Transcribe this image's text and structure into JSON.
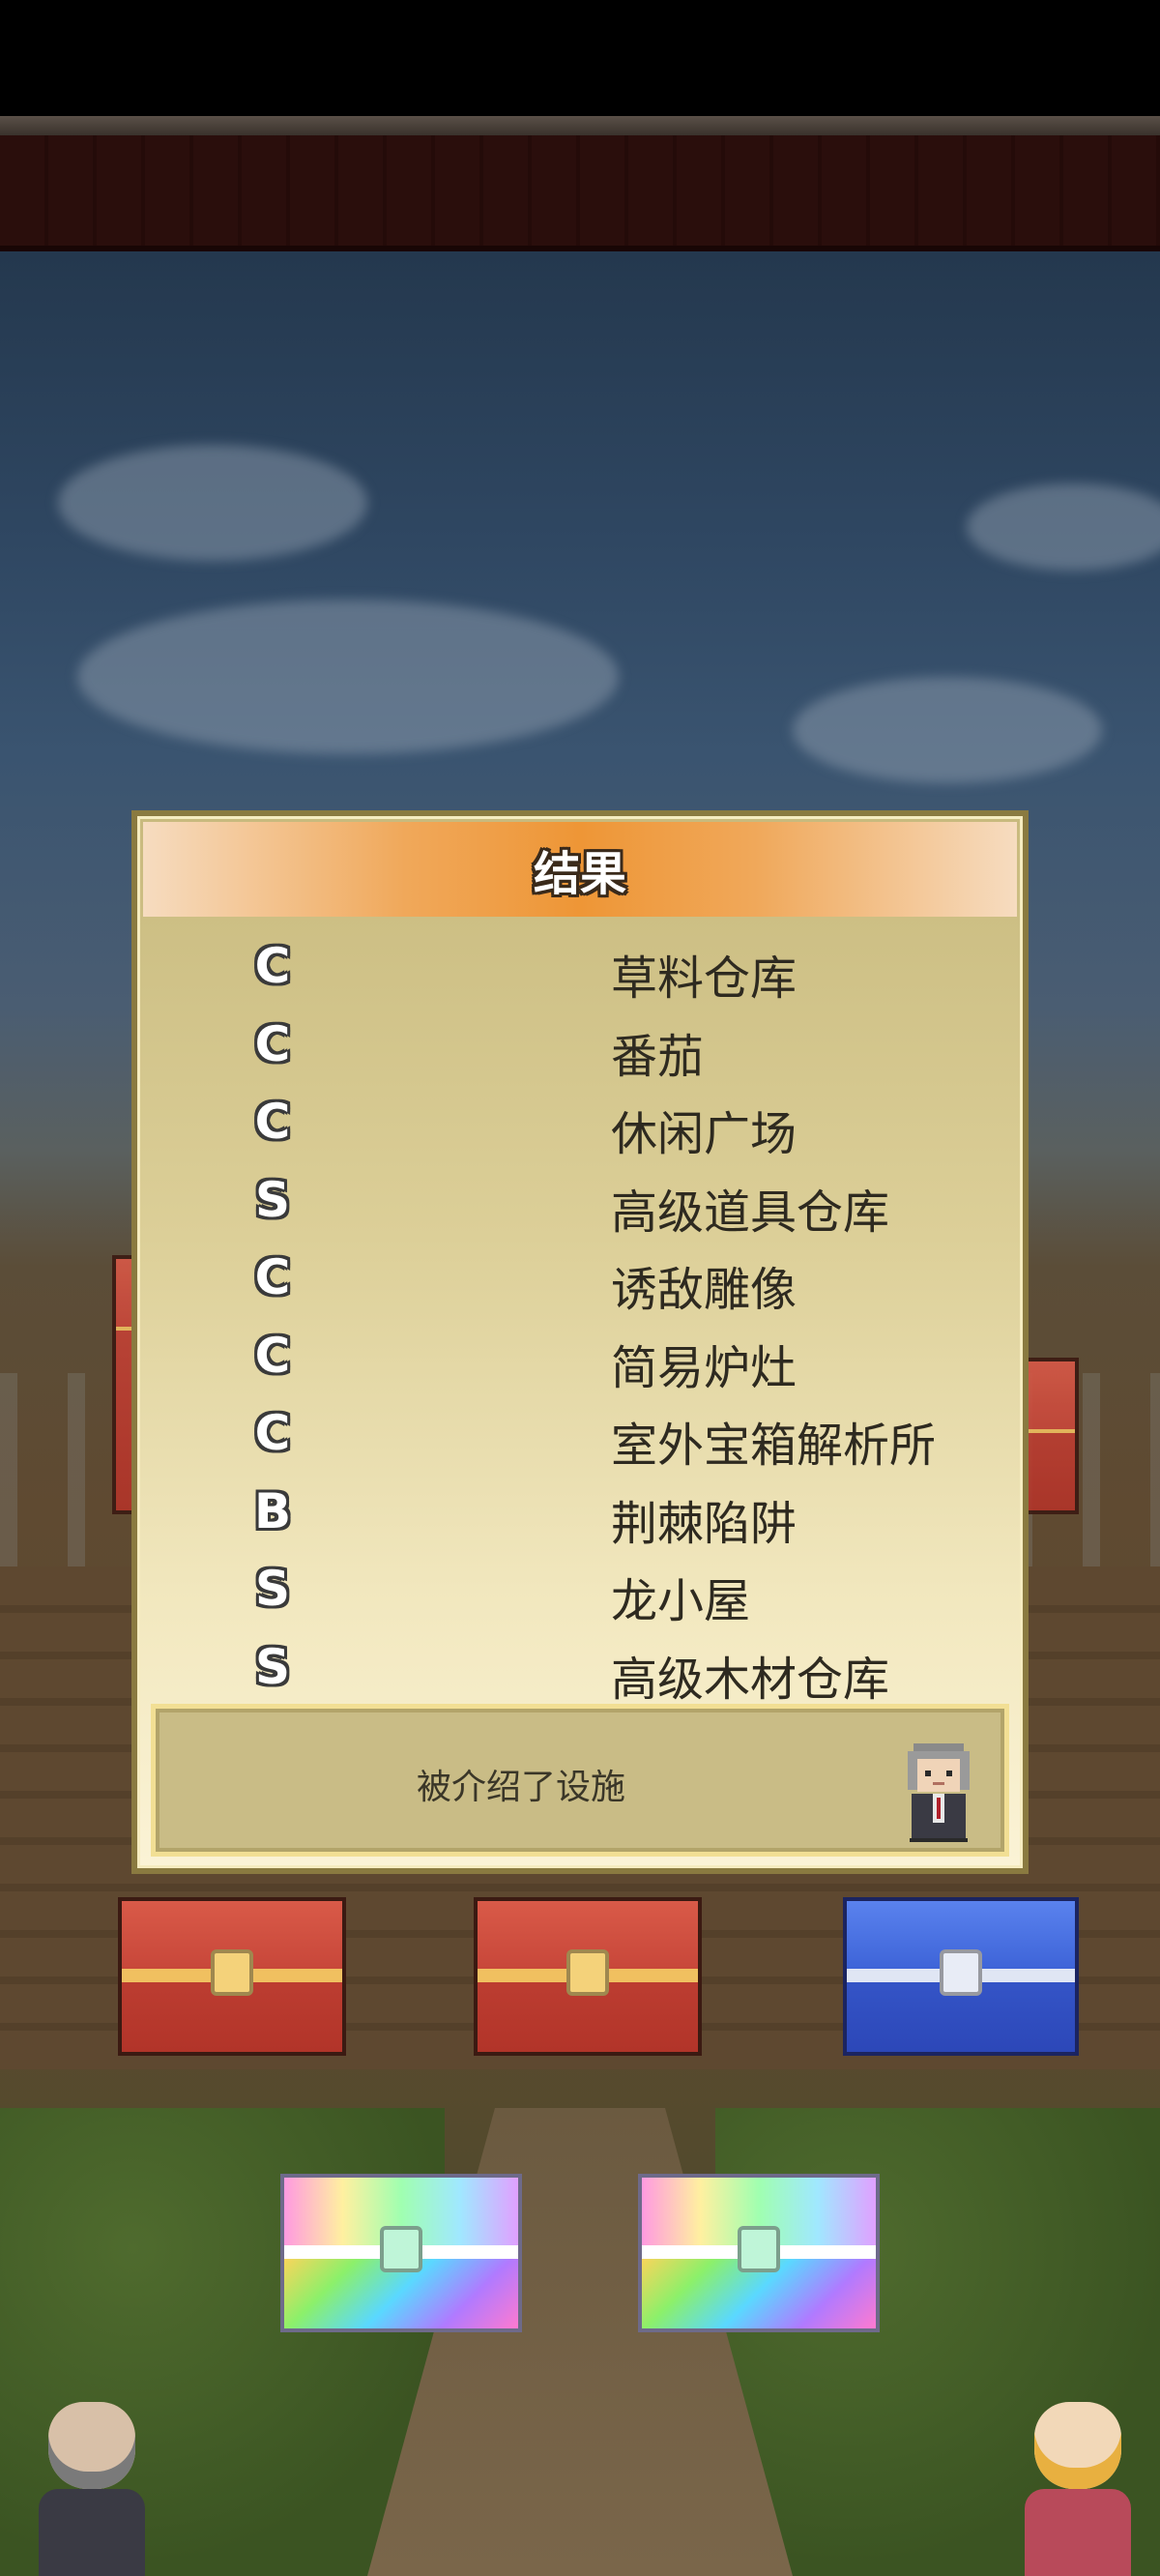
{
  "dialog": {
    "title": "结果",
    "results": [
      {
        "grade": "C",
        "name": "草料仓库"
      },
      {
        "grade": "C",
        "name": "番茄"
      },
      {
        "grade": "C",
        "name": "休闲广场"
      },
      {
        "grade": "S",
        "name": "高级道具仓库"
      },
      {
        "grade": "C",
        "name": "诱敌雕像"
      },
      {
        "grade": "C",
        "name": "简易炉灶"
      },
      {
        "grade": "C",
        "name": "室外宝箱解析所"
      },
      {
        "grade": "B",
        "name": "荆棘陷阱"
      },
      {
        "grade": "S",
        "name": "龙小屋"
      },
      {
        "grade": "S",
        "name": "高级木材仓库"
      }
    ],
    "message": "被介绍了设施"
  },
  "chests": [
    {
      "type": "red",
      "icon": "red-treasure-chest-icon"
    },
    {
      "type": "red",
      "icon": "red-treasure-chest-icon"
    },
    {
      "type": "blue",
      "icon": "blue-treasure-chest-icon"
    },
    {
      "type": "rainbow",
      "icon": "rainbow-treasure-chest-icon"
    },
    {
      "type": "rainbow",
      "icon": "rainbow-treasure-chest-icon"
    }
  ],
  "colors": {
    "header_orange": "#ee9636",
    "dialog_bg": "#f2e8bf",
    "chest_red": "#c8473a",
    "chest_blue": "#3e64d8"
  }
}
